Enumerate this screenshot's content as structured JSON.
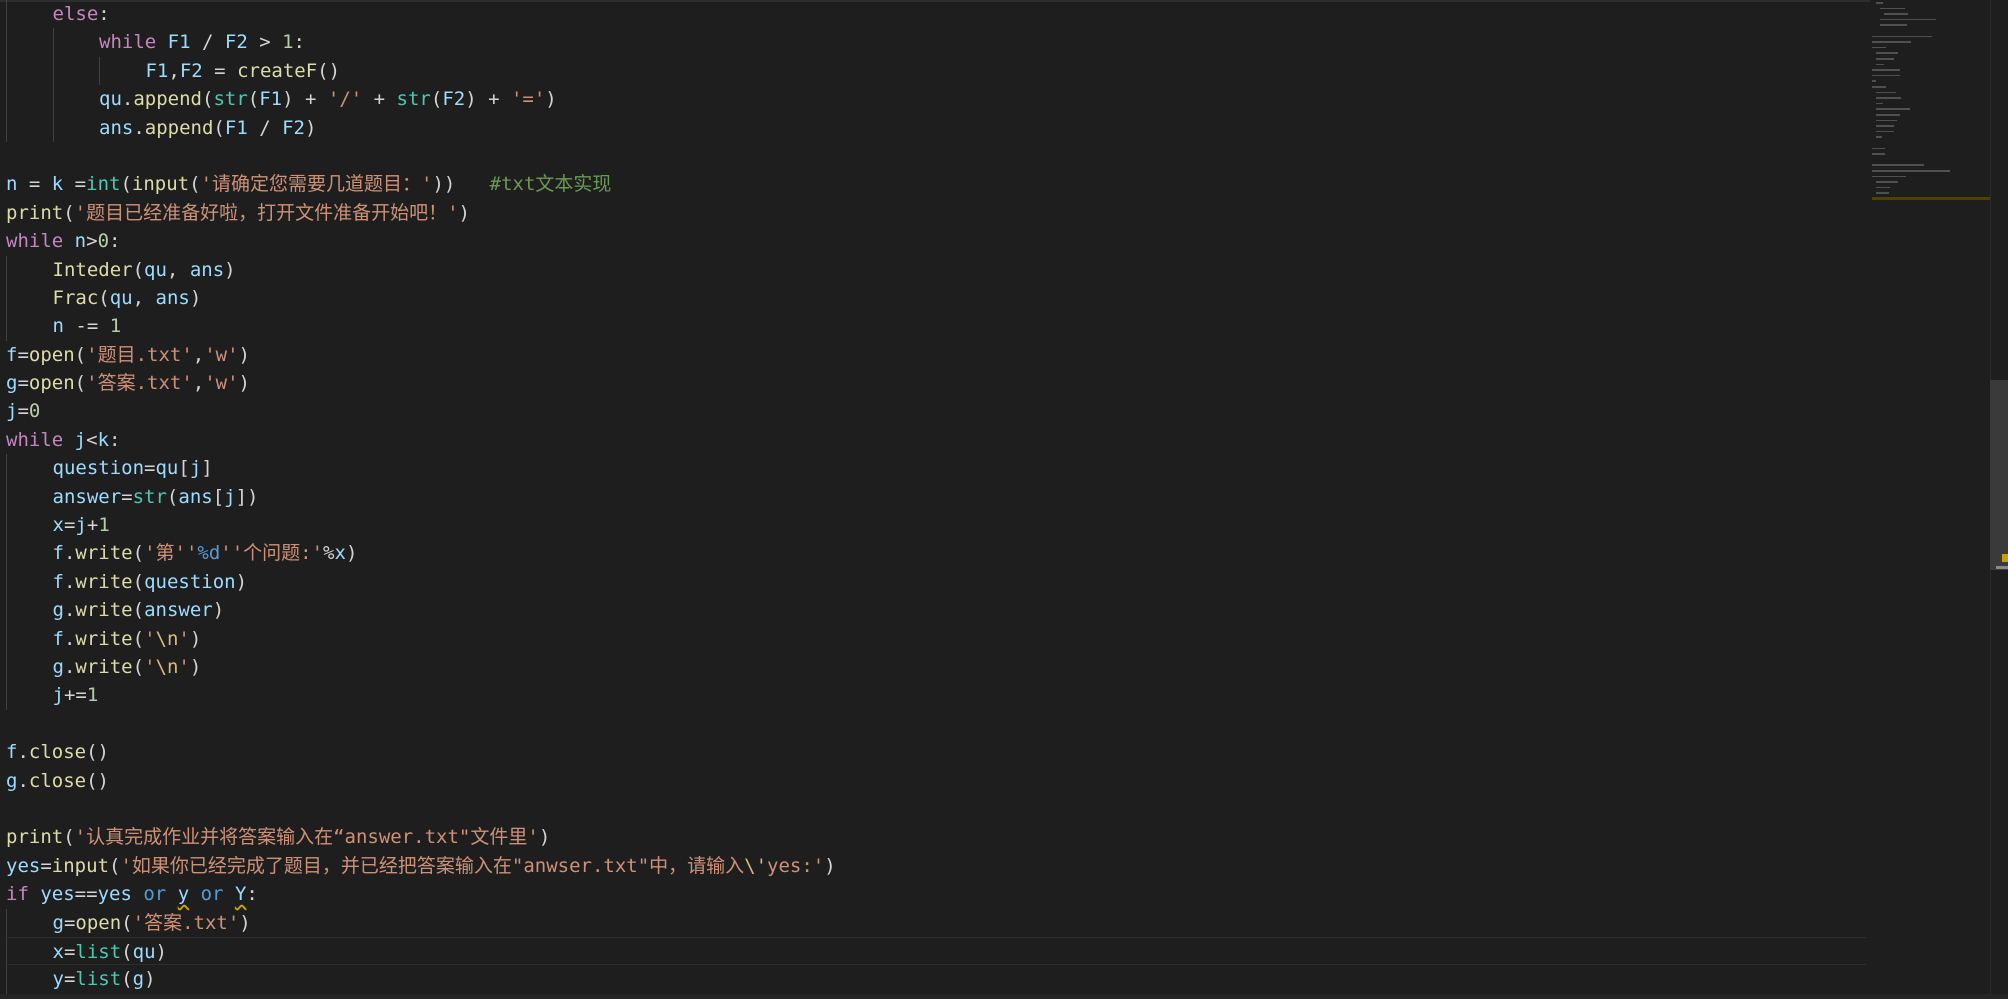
{
  "editor": {
    "language": "python",
    "cursor_line_index": 33,
    "colors": {
      "background": "#1e1e1e",
      "keyword": "#c586c0",
      "variable": "#9cdcfe",
      "function": "#dcdcaa",
      "builtin": "#4ec9b0",
      "string": "#ce9178",
      "number": "#b5cea8",
      "comment": "#6a9955"
    },
    "lines": [
      {
        "indent": 1,
        "tokens": [
          [
            "kw",
            "else"
          ],
          [
            "txt",
            ":"
          ]
        ]
      },
      {
        "indent": 2,
        "tokens": [
          [
            "kw",
            "while"
          ],
          [
            "txt",
            " "
          ],
          [
            "var",
            "F1"
          ],
          [
            "txt",
            " / "
          ],
          [
            "var",
            "F2"
          ],
          [
            "txt",
            " > "
          ],
          [
            "num",
            "1"
          ],
          [
            "txt",
            ":"
          ]
        ]
      },
      {
        "indent": 3,
        "tokens": [
          [
            "var",
            "F1"
          ],
          [
            "txt",
            ","
          ],
          [
            "var",
            "F2"
          ],
          [
            "txt",
            " = "
          ],
          [
            "fn",
            "createF"
          ],
          [
            "txt",
            "()"
          ]
        ]
      },
      {
        "indent": 2,
        "tokens": [
          [
            "var",
            "qu"
          ],
          [
            "txt",
            "."
          ],
          [
            "fn",
            "append"
          ],
          [
            "txt",
            "("
          ],
          [
            "bi",
            "str"
          ],
          [
            "txt",
            "("
          ],
          [
            "var",
            "F1"
          ],
          [
            "txt",
            ") + "
          ],
          [
            "str",
            "'/'"
          ],
          [
            "txt",
            " + "
          ],
          [
            "bi",
            "str"
          ],
          [
            "txt",
            "("
          ],
          [
            "var",
            "F2"
          ],
          [
            "txt",
            ") + "
          ],
          [
            "str",
            "'='"
          ],
          [
            "txt",
            ")"
          ]
        ]
      },
      {
        "indent": 2,
        "tokens": [
          [
            "var",
            "ans"
          ],
          [
            "txt",
            "."
          ],
          [
            "fn",
            "append"
          ],
          [
            "txt",
            "("
          ],
          [
            "var",
            "F1"
          ],
          [
            "txt",
            " / "
          ],
          [
            "var",
            "F2"
          ],
          [
            "txt",
            ")"
          ]
        ]
      },
      {
        "indent": 0,
        "tokens": []
      },
      {
        "indent": 0,
        "tokens": [
          [
            "var",
            "n"
          ],
          [
            "txt",
            " = "
          ],
          [
            "var",
            "k"
          ],
          [
            "txt",
            " ="
          ],
          [
            "bi",
            "int"
          ],
          [
            "txt",
            "("
          ],
          [
            "fn",
            "input"
          ],
          [
            "txt",
            "("
          ],
          [
            "str",
            "'请确定您需要几道题目：'"
          ],
          [
            "txt",
            "))   "
          ],
          [
            "cmt",
            "#txt文本实现"
          ]
        ]
      },
      {
        "indent": 0,
        "tokens": [
          [
            "fn",
            "print"
          ],
          [
            "txt",
            "("
          ],
          [
            "str",
            "'题目已经准备好啦，打开文件准备开始吧！'"
          ],
          [
            "txt",
            ")"
          ]
        ]
      },
      {
        "indent": 0,
        "tokens": [
          [
            "kw",
            "while"
          ],
          [
            "txt",
            " "
          ],
          [
            "var",
            "n"
          ],
          [
            "txt",
            ">"
          ],
          [
            "num",
            "0"
          ],
          [
            "txt",
            ":"
          ]
        ]
      },
      {
        "indent": 1,
        "tokens": [
          [
            "fn",
            "Inteder"
          ],
          [
            "txt",
            "("
          ],
          [
            "var",
            "qu"
          ],
          [
            "txt",
            ", "
          ],
          [
            "var",
            "ans"
          ],
          [
            "txt",
            ")"
          ]
        ]
      },
      {
        "indent": 1,
        "tokens": [
          [
            "fn",
            "Frac"
          ],
          [
            "txt",
            "("
          ],
          [
            "var",
            "qu"
          ],
          [
            "txt",
            ", "
          ],
          [
            "var",
            "ans"
          ],
          [
            "txt",
            ")"
          ]
        ]
      },
      {
        "indent": 1,
        "tokens": [
          [
            "var",
            "n"
          ],
          [
            "txt",
            " -= "
          ],
          [
            "num",
            "1"
          ]
        ]
      },
      {
        "indent": 0,
        "tokens": [
          [
            "var",
            "f"
          ],
          [
            "txt",
            "="
          ],
          [
            "fn",
            "open"
          ],
          [
            "txt",
            "("
          ],
          [
            "str",
            "'题目.txt'"
          ],
          [
            "txt",
            ","
          ],
          [
            "str",
            "'w'"
          ],
          [
            "txt",
            ")"
          ]
        ]
      },
      {
        "indent": 0,
        "tokens": [
          [
            "var",
            "g"
          ],
          [
            "txt",
            "="
          ],
          [
            "fn",
            "open"
          ],
          [
            "txt",
            "("
          ],
          [
            "str",
            "'答案.txt'"
          ],
          [
            "txt",
            ","
          ],
          [
            "str",
            "'w'"
          ],
          [
            "txt",
            ")"
          ]
        ]
      },
      {
        "indent": 0,
        "tokens": [
          [
            "var",
            "j"
          ],
          [
            "txt",
            "="
          ],
          [
            "num",
            "0"
          ]
        ]
      },
      {
        "indent": 0,
        "tokens": [
          [
            "kw",
            "while"
          ],
          [
            "txt",
            " "
          ],
          [
            "var",
            "j"
          ],
          [
            "txt",
            "<"
          ],
          [
            "var",
            "k"
          ],
          [
            "txt",
            ":"
          ]
        ]
      },
      {
        "indent": 1,
        "tokens": [
          [
            "var",
            "question"
          ],
          [
            "txt",
            "="
          ],
          [
            "var",
            "qu"
          ],
          [
            "txt",
            "["
          ],
          [
            "var",
            "j"
          ],
          [
            "txt",
            "]"
          ]
        ]
      },
      {
        "indent": 1,
        "tokens": [
          [
            "var",
            "answer"
          ],
          [
            "txt",
            "="
          ],
          [
            "bi",
            "str"
          ],
          [
            "txt",
            "("
          ],
          [
            "var",
            "ans"
          ],
          [
            "txt",
            "["
          ],
          [
            "var",
            "j"
          ],
          [
            "txt",
            "])"
          ]
        ]
      },
      {
        "indent": 1,
        "tokens": [
          [
            "var",
            "x"
          ],
          [
            "txt",
            "="
          ],
          [
            "var",
            "j"
          ],
          [
            "txt",
            "+"
          ],
          [
            "num",
            "1"
          ]
        ]
      },
      {
        "indent": 1,
        "tokens": [
          [
            "var",
            "f"
          ],
          [
            "txt",
            "."
          ],
          [
            "fn",
            "write"
          ],
          [
            "txt",
            "("
          ],
          [
            "str",
            "'第''"
          ],
          [
            "ctl",
            "%d"
          ],
          [
            "str",
            "''个问题:'"
          ],
          [
            "txt",
            "%"
          ],
          [
            "var",
            "x"
          ],
          [
            "txt",
            ")"
          ]
        ]
      },
      {
        "indent": 1,
        "tokens": [
          [
            "var",
            "f"
          ],
          [
            "txt",
            "."
          ],
          [
            "fn",
            "write"
          ],
          [
            "txt",
            "("
          ],
          [
            "var",
            "question"
          ],
          [
            "txt",
            ")"
          ]
        ]
      },
      {
        "indent": 1,
        "tokens": [
          [
            "var",
            "g"
          ],
          [
            "txt",
            "."
          ],
          [
            "fn",
            "write"
          ],
          [
            "txt",
            "("
          ],
          [
            "var",
            "answer"
          ],
          [
            "txt",
            ")"
          ]
        ]
      },
      {
        "indent": 1,
        "tokens": [
          [
            "var",
            "f"
          ],
          [
            "txt",
            "."
          ],
          [
            "fn",
            "write"
          ],
          [
            "txt",
            "("
          ],
          [
            "str",
            "'"
          ],
          [
            "esc",
            "\\n"
          ],
          [
            "str",
            "'"
          ],
          [
            "txt",
            ")"
          ]
        ]
      },
      {
        "indent": 1,
        "tokens": [
          [
            "var",
            "g"
          ],
          [
            "txt",
            "."
          ],
          [
            "fn",
            "write"
          ],
          [
            "txt",
            "("
          ],
          [
            "str",
            "'"
          ],
          [
            "esc",
            "\\n"
          ],
          [
            "str",
            "'"
          ],
          [
            "txt",
            ")"
          ]
        ]
      },
      {
        "indent": 1,
        "tokens": [
          [
            "var",
            "j"
          ],
          [
            "txt",
            "+="
          ],
          [
            "num",
            "1"
          ]
        ]
      },
      {
        "indent": 0,
        "tokens": []
      },
      {
        "indent": 0,
        "tokens": [
          [
            "var",
            "f"
          ],
          [
            "txt",
            "."
          ],
          [
            "fn",
            "close"
          ],
          [
            "txt",
            "()"
          ]
        ]
      },
      {
        "indent": 0,
        "tokens": [
          [
            "var",
            "g"
          ],
          [
            "txt",
            "."
          ],
          [
            "fn",
            "close"
          ],
          [
            "txt",
            "()"
          ]
        ]
      },
      {
        "indent": 0,
        "tokens": []
      },
      {
        "indent": 0,
        "tokens": [
          [
            "fn",
            "print"
          ],
          [
            "txt",
            "("
          ],
          [
            "str",
            "'认真完成作业并将答案输入在“answer.txt\"文件里'"
          ],
          [
            "txt",
            ")"
          ]
        ]
      },
      {
        "indent": 0,
        "tokens": [
          [
            "var",
            "yes"
          ],
          [
            "txt",
            "="
          ],
          [
            "fn",
            "input"
          ],
          [
            "txt",
            "("
          ],
          [
            "str",
            "'如果你已经完成了题目，并已经把答案输入在\"anwser.txt\"中，请输入"
          ],
          [
            "esc",
            "\\'"
          ],
          [
            "str",
            "yes:'"
          ],
          [
            "txt",
            ")"
          ]
        ]
      },
      {
        "indent": 0,
        "tokens": [
          [
            "kw",
            "if"
          ],
          [
            "txt",
            " "
          ],
          [
            "var",
            "yes"
          ],
          [
            "txt",
            "=="
          ],
          [
            "var",
            "yes"
          ],
          [
            "txt",
            " "
          ],
          [
            "ctl",
            "or"
          ],
          [
            "txt",
            " "
          ],
          [
            "var",
            "y~"
          ],
          [
            "txt",
            " "
          ],
          [
            "ctl",
            "or"
          ],
          [
            "txt",
            " "
          ],
          [
            "var",
            "Y~"
          ],
          [
            "txt",
            ":"
          ]
        ]
      },
      {
        "indent": 1,
        "tokens": [
          [
            "var",
            "g"
          ],
          [
            "txt",
            "="
          ],
          [
            "fn",
            "open"
          ],
          [
            "txt",
            "("
          ],
          [
            "str",
            "'答案.txt'"
          ],
          [
            "txt",
            ")"
          ]
        ]
      },
      {
        "indent": 1,
        "tokens": [
          [
            "var",
            "x"
          ],
          [
            "txt",
            "="
          ],
          [
            "bi",
            "list"
          ],
          [
            "txt",
            "("
          ],
          [
            "var",
            "qu"
          ],
          [
            "txt",
            ")"
          ]
        ]
      },
      {
        "indent": 1,
        "tokens": [
          [
            "var",
            "y"
          ],
          [
            "txt",
            "="
          ],
          [
            "bi",
            "list"
          ],
          [
            "txt",
            "("
          ],
          [
            "var",
            "g"
          ],
          [
            "txt",
            ")"
          ]
        ]
      }
    ]
  },
  "minimap": {
    "label": "minimap",
    "highlight_color": "#4d4200"
  },
  "scrollbar": {
    "thumb_color": "#3a3a3a",
    "marker_color": "#c8a000"
  }
}
